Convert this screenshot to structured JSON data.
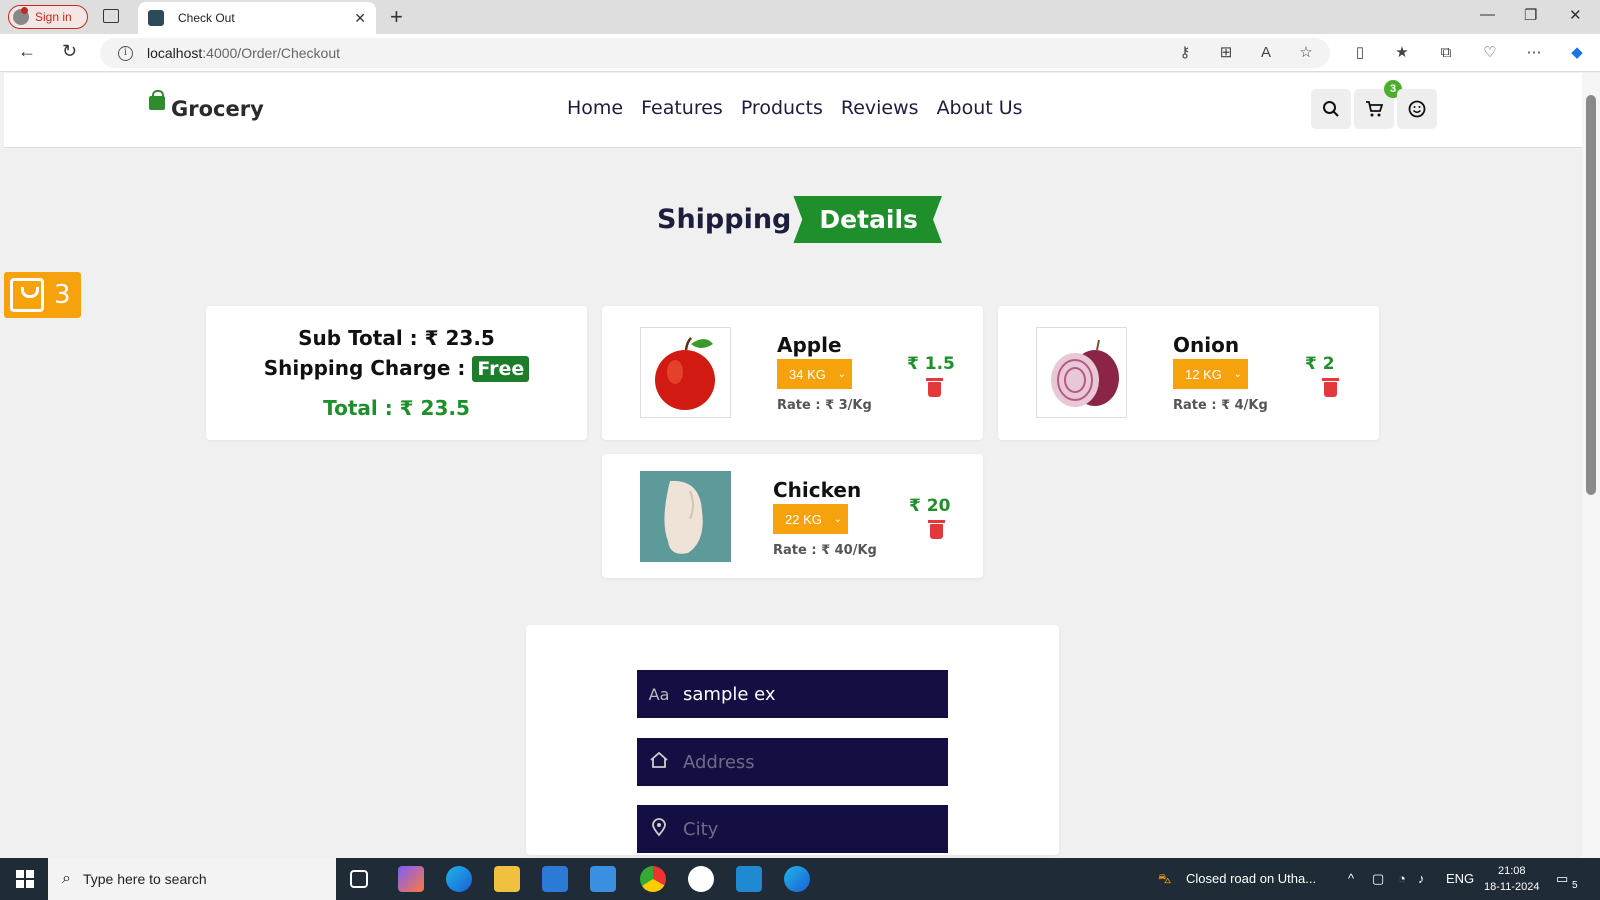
{
  "browser": {
    "signin_label": "Sign in",
    "tab_title": "Check Out",
    "url_host": "localhost",
    "url_path": ":4000/Order/Checkout"
  },
  "header": {
    "logo": "Grocery",
    "nav": [
      "Home",
      "Features",
      "Products",
      "Reviews",
      "About Us"
    ],
    "cart_count": "3"
  },
  "page": {
    "title_part1": "Shipping",
    "title_part2": "Details",
    "float_cart_count": "3"
  },
  "summary": {
    "subtotal": "Sub Total : ₹ 23.5",
    "shipping_label": "Shipping Charge :",
    "shipping_value": "Free",
    "total": "Total : ₹ 23.5"
  },
  "items": [
    {
      "name": "Apple",
      "qty": "34 KG",
      "rate": "Rate : ₹ 3/Kg",
      "price": "₹ 1.5"
    },
    {
      "name": "Onion",
      "qty": "12 KG",
      "rate": "Rate : ₹ 4/Kg",
      "price": "₹ 2"
    },
    {
      "name": "Chicken",
      "qty": "22 KG",
      "rate": "Rate : ₹ 40/Kg",
      "price": "₹ 20"
    }
  ],
  "form": {
    "name_value": "sample ex",
    "name_icon_text": "Aa",
    "address_placeholder": "Address",
    "city_placeholder": "City"
  },
  "taskbar": {
    "search_placeholder": "Type here to search",
    "news": "Closed road on Utha...",
    "lang": "ENG",
    "time": "21:08",
    "date": "18-11-2024",
    "notif_count": "5"
  },
  "colors": {
    "brand_green": "#1e8f2a",
    "accent_orange": "#f5a20c",
    "field_navy": "#140f42",
    "delete_red": "#e5383b"
  }
}
